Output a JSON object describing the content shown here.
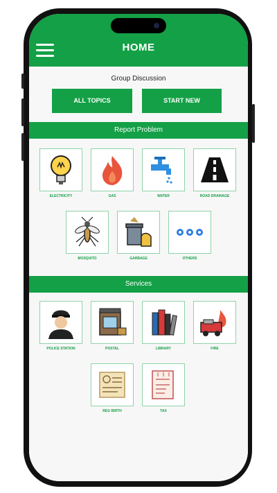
{
  "header": {
    "title": "HOME"
  },
  "group_discussion": {
    "label": "Group Discussion",
    "all_topics": "ALL TOPICS",
    "start_new": "START NEW"
  },
  "report_problem": {
    "title": "Report Problem",
    "items": [
      {
        "label": "ELECTRICITY",
        "icon": "light-bulb-icon"
      },
      {
        "label": "GAS",
        "icon": "flame-icon"
      },
      {
        "label": "WATER",
        "icon": "water-tap-icon"
      },
      {
        "label": "ROAD DRAINAGE",
        "icon": "road-icon"
      },
      {
        "label": "MOSQUITO",
        "icon": "mosquito-icon"
      },
      {
        "label": "GARBAGE",
        "icon": "garbage-icon"
      },
      {
        "label": "OTHERS",
        "icon": "more-dots-icon"
      }
    ]
  },
  "services": {
    "title": "Services",
    "items": [
      {
        "label": "POLICE STATION",
        "icon": "police-officer-icon"
      },
      {
        "label": "POSTAL",
        "icon": "post-office-icon"
      },
      {
        "label": "LIBRARY",
        "icon": "books-icon"
      },
      {
        "label": "FIRE",
        "icon": "fire-truck-icon"
      },
      {
        "label": "REG BIRTH",
        "icon": "birth-certificate-icon"
      },
      {
        "label": "TAX",
        "icon": "tax-document-icon"
      }
    ]
  },
  "colors": {
    "accent": "#14a046",
    "tile_border": "#8fd3a8"
  }
}
